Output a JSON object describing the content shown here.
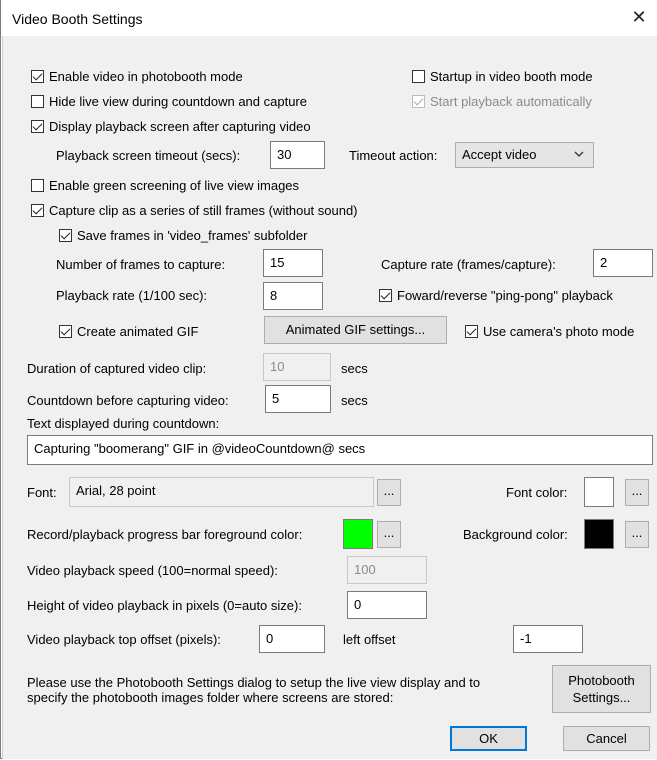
{
  "window": {
    "title": "Video Booth Settings",
    "close_glyph": "✕"
  },
  "options": {
    "enable_video": {
      "label": "Enable video in photobooth mode",
      "checked": true
    },
    "startup_video_booth": {
      "label": "Startup in video booth mode",
      "checked": false
    },
    "hide_live_view": {
      "label": "Hide live view during countdown and capture",
      "checked": false
    },
    "start_playback_auto": {
      "label": "Start playback automatically",
      "checked": true,
      "disabled": true
    },
    "display_playback_screen": {
      "label": "Display playback screen after capturing video",
      "checked": true
    },
    "playback_timeout_label": "Playback screen timeout (secs):",
    "playback_timeout_value": "30",
    "timeout_action_label": "Timeout action:",
    "timeout_action_value": "Accept video",
    "enable_green_screen": {
      "label": "Enable green screening of live view images",
      "checked": false
    },
    "capture_still_frames": {
      "label": "Capture clip as a series of still frames (without sound)",
      "checked": true
    },
    "save_frames_subfolder": {
      "label": "Save frames in 'video_frames' subfolder",
      "checked": true
    },
    "frames_to_capture_label": "Number of frames to capture:",
    "frames_to_capture_value": "15",
    "capture_rate_label": "Capture rate (frames/capture):",
    "capture_rate_value": "2",
    "playback_rate_label": "Playback rate (1/100 sec):",
    "playback_rate_value": "8",
    "ping_pong": {
      "label": "Foward/reverse \"ping-pong\" playback",
      "checked": true
    },
    "create_gif": {
      "label": "Create animated GIF",
      "checked": true
    },
    "gif_settings_button": "Animated GIF settings...",
    "use_camera_photo_mode": {
      "label": "Use camera's photo mode",
      "checked": true
    },
    "duration_label": "Duration of captured video clip:",
    "duration_value": "10",
    "duration_unit": "secs",
    "countdown_label": "Countdown before capturing video:",
    "countdown_value": "5",
    "countdown_unit": "secs",
    "countdown_text_label": "Text displayed during countdown:",
    "countdown_text_value": "Capturing \"boomerang\" GIF in @videoCountdown@ secs",
    "font_label": "Font:",
    "font_value": "Arial, 28 point",
    "ellipsis": "...",
    "font_color_label": "Font color:",
    "font_color": "#ffffff",
    "progress_fg_label": "Record/playback progress bar foreground color:",
    "progress_fg_color": "#00ff00",
    "background_color_label": "Background color:",
    "background_color": "#000000",
    "playback_speed_label": "Video playback speed (100=normal speed):",
    "playback_speed_value": "100",
    "height_label": "Height of video playback in pixels (0=auto size):",
    "height_value": "0",
    "top_offset_label": "Video playback top offset (pixels):",
    "top_offset_value": "0",
    "left_offset_label": "left offset",
    "left_offset_value": "-1",
    "info_line1": "Please use the Photobooth Settings dialog to setup the live view display and to",
    "info_line2": "specify the photobooth images folder where screens are stored:",
    "photobooth_settings_line1": "Photobooth",
    "photobooth_settings_line2": "Settings...",
    "ok_button": "OK",
    "cancel_button": "Cancel"
  }
}
